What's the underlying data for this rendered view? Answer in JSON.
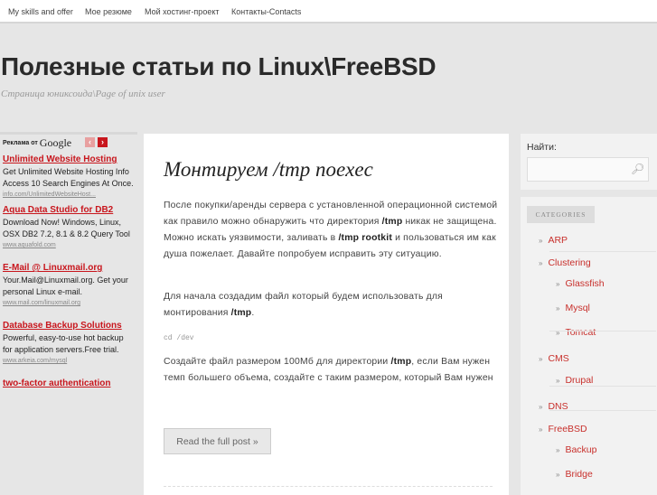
{
  "nav": [
    "My skills and offer",
    "Мое резюме",
    "Мой хостинг-проект",
    "Контакты-Contacts"
  ],
  "site": {
    "title": "Полезные статьи по Linux\\FreeBSD",
    "description": "Страница юниксоида\\Page of unix user"
  },
  "ads": {
    "header": "Реклама от",
    "google": "Google",
    "prev": "‹",
    "next": "›",
    "items": [
      {
        "title": "Unlimited Website Hosting",
        "text": "Get Unlimited Website Hosting Info Access 10 Search Engines At Once.",
        "url": "info.com/UnlimitedWebsiteHost..."
      },
      {
        "title": "Aqua Data Studio for DB2",
        "text": "Download Now! Windows, Linux, OSX DB2 7.2, 8.1 & 8.2 Query Tool",
        "url": "www.aquafold.com"
      },
      {
        "title": "E-Mail @ Linuxmail.org",
        "text": "Your.Mail@Linuxmail.org. Get your personal Linux e-mail.",
        "url": "www.mail.com/linuxmail.org"
      },
      {
        "title": "Database Backup Solutions",
        "text": "Powerful, easy-to-use hot backup for application servers.Free trial.",
        "url": "www.arkeia.com/mysql"
      },
      {
        "title": "two-factor authentication",
        "text": "",
        "url": ""
      }
    ]
  },
  "post": {
    "title": "Монтируем /tmp noexec",
    "p1": [
      "После покупки/аренды сервера с установленной операционной системой как правило можно обнаружить что директория ",
      "/tmp",
      " никак не защищена. Можно искать уязвимости, заливать в ",
      "/tmp rootkit",
      " и пользоваться им как душа пожелает. Давайте попробуем исправить эту ситуацию."
    ],
    "p2": [
      "Для начала создадим файл который будем использовать для монтирования ",
      "/tmp",
      "."
    ],
    "code": "cd /dev",
    "p3": [
      "Создайте файл размером 100Мб для директории ",
      "/tmp",
      ", если Вам нужен темп большего объема, создайте с таким размером, который Вам нужен"
    ],
    "read_more": "Read the full post »"
  },
  "sidebar": {
    "search_label": "Найти:",
    "categories_title": "CATEGORIES",
    "bullet": "»",
    "categories": [
      "ARP",
      "Clustering",
      "Glassfish",
      "Mysql",
      "Tomcat",
      "CMS",
      "Drupal",
      "DNS",
      "FreeBSD",
      "Backup",
      "Bridge"
    ]
  }
}
